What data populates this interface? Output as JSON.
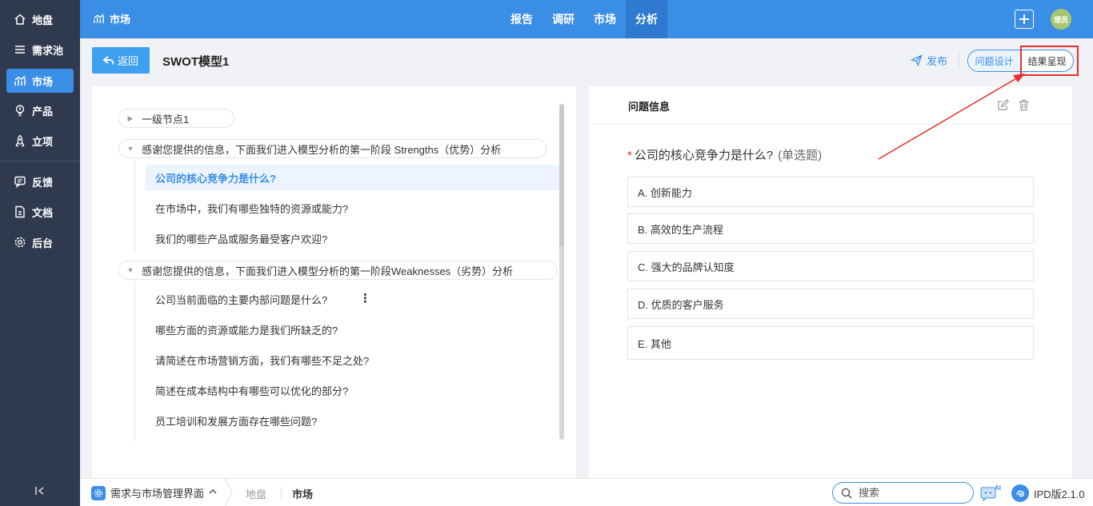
{
  "sidebar": {
    "items": [
      {
        "label": "地盘",
        "icon": "home-icon"
      },
      {
        "label": "需求池",
        "icon": "list-icon"
      },
      {
        "label": "市场",
        "icon": "chart-icon"
      },
      {
        "label": "产品",
        "icon": "bulb-icon"
      },
      {
        "label": "立项",
        "icon": "rocket-icon"
      },
      {
        "label": "反馈",
        "icon": "feedback-icon"
      },
      {
        "label": "文档",
        "icon": "document-icon"
      },
      {
        "label": "后台",
        "icon": "settings-icon"
      }
    ],
    "active_index": 2
  },
  "topbar": {
    "brand": "市场",
    "nav": [
      {
        "label": "报告"
      },
      {
        "label": "调研"
      },
      {
        "label": "市场"
      },
      {
        "label": "分析"
      }
    ],
    "active_nav_index": 3,
    "avatar_text": "理员",
    "avatar_color": "#a6c76f",
    "accent_color": "#3a8ee6"
  },
  "header": {
    "back_label": "返回",
    "title": "SWOT模型1",
    "publish_label": "发布",
    "segment": {
      "design_label": "问题设计",
      "result_label": "结果呈现"
    }
  },
  "tree": {
    "node1": "一级节点1",
    "node2": "感谢您提供的信息，下面我们进入模型分析的第一阶段 Strengths（优势）分析",
    "node2_questions": [
      "公司的核心竞争力是什么?",
      "在市场中，我们有哪些独特的资源或能力?",
      "我们的哪些产品或服务最受客户欢迎?"
    ],
    "node3": "感谢您提供的信息，下面我们进入模型分析的第一阶段Weaknesses（劣势）分析",
    "node3_questions": [
      "公司当前面临的主要内部问题是什么?",
      "哪些方面的资源或能力是我们所缺乏的?",
      "请简述在市场营销方面，我们有哪些不足之处?",
      "简述在成本结构中有哪些可以优化的部分?",
      "员工培训和发展方面存在哪些问题?"
    ]
  },
  "detail": {
    "panel_title": "问题信息",
    "question": "公司的核心竞争力是什么?",
    "question_type": "(单选题)",
    "required_mark": "*",
    "options": [
      "A. 创新能力",
      "B. 高效的生产流程",
      "C. 强大的品牌认知度",
      "D. 优质的客户服务",
      "E. 其他"
    ]
  },
  "bottombar": {
    "app_label": "需求与市场管理界面",
    "crumb1": "地盘",
    "crumb2": "市场",
    "search_placeholder": "搜索",
    "ai_label": "AI",
    "version": "IPD版2.1.0"
  }
}
